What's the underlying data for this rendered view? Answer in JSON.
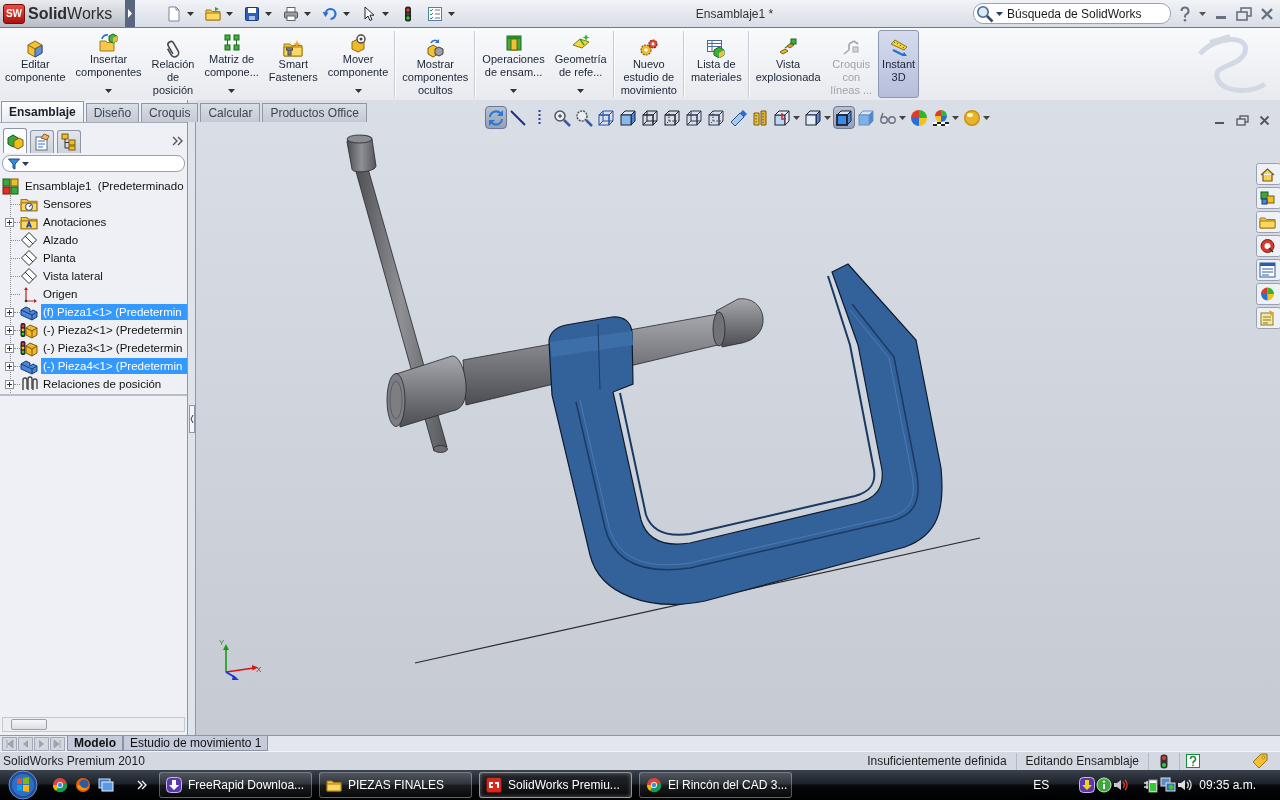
{
  "titlebar": {
    "logo_mark": "SW",
    "logo": "**Solid**Works",
    "title": "Ensamblaje1 *",
    "search": {
      "placeholder": "Búsqueda de SolidWorks"
    }
  },
  "ribbon": {
    "groups": [
      [
        {
          "label": "Editar\ncomponente",
          "dropdown": false,
          "disabled": false,
          "selected": false
        },
        {
          "label": "Insertar\ncomponentes",
          "dropdown": true,
          "disabled": false,
          "selected": false
        },
        {
          "label": "Relación\nde\nposición",
          "dropdown": false,
          "disabled": false,
          "selected": false
        },
        {
          "label": "Matriz de\ncompone...",
          "dropdown": true,
          "disabled": false,
          "selected": false
        },
        {
          "label": "Smart\nFasteners",
          "dropdown": false,
          "disabled": false,
          "selected": false
        },
        {
          "label": "Mover\ncomponente",
          "dropdown": true,
          "disabled": false,
          "selected": false
        }
      ],
      [
        {
          "label": "Mostrar\ncomponentes\nocultos",
          "dropdown": false,
          "disabled": false,
          "selected": false
        }
      ],
      [
        {
          "label": "Operaciones\nde ensam...",
          "dropdown": true,
          "disabled": false,
          "selected": false
        },
        {
          "label": "Geometría\nde refe...",
          "dropdown": true,
          "disabled": false,
          "selected": false
        }
      ],
      [
        {
          "label": "Nuevo\nestudio de\nmovimiento",
          "dropdown": false,
          "disabled": false,
          "selected": false
        }
      ],
      [
        {
          "label": "Lista de\nmateriales",
          "dropdown": false,
          "disabled": false,
          "selected": false
        }
      ],
      [
        {
          "label": "Vista\nexplosionada",
          "dropdown": false,
          "disabled": false,
          "selected": false
        },
        {
          "label": "Croquis\ncon\nlíneas ...",
          "dropdown": false,
          "disabled": true,
          "selected": false
        },
        {
          "label": "Instant\n3D",
          "dropdown": false,
          "disabled": false,
          "selected": true
        }
      ]
    ]
  },
  "command_tabs": [
    {
      "label": "Ensamblaje",
      "selected": true
    },
    {
      "label": "Diseño",
      "selected": false
    },
    {
      "label": "Croquis",
      "selected": false
    },
    {
      "label": "Calcular",
      "selected": false
    },
    {
      "label": "Productos Office",
      "selected": false
    }
  ],
  "panel_tabs": [
    {
      "selected": true
    },
    {
      "selected": false
    },
    {
      "selected": false
    }
  ],
  "feature_tree": {
    "root": {
      "label": "Ensamblaje1  (Predeterminado",
      "kind": "assembly",
      "selected": false,
      "children": [
        {
          "label": "Sensores",
          "kind": "sensors",
          "expandable": false,
          "selected": false
        },
        {
          "label": "Anotaciones",
          "kind": "annotations",
          "expandable": true,
          "selected": false
        },
        {
          "label": "Alzado",
          "kind": "plane",
          "expandable": false,
          "selected": false
        },
        {
          "label": "Planta",
          "kind": "plane",
          "expandable": false,
          "selected": false
        },
        {
          "label": "Vista lateral",
          "kind": "plane",
          "expandable": false,
          "selected": false
        },
        {
          "label": "Origen",
          "kind": "origin",
          "expandable": false,
          "selected": false
        },
        {
          "label": "(f) Pieza1<1> (Predetermin",
          "kind": "part",
          "expandable": true,
          "selected": true
        },
        {
          "label": "(-) Pieza2<1> (Predetermin",
          "kind": "part_rebuild",
          "expandable": true,
          "selected": false
        },
        {
          "label": "(-) Pieza3<1> (Predetermin",
          "kind": "part_rebuild",
          "expandable": true,
          "selected": false
        },
        {
          "label": "(-) Pieza4<1> (Predetermin",
          "kind": "part",
          "expandable": true,
          "selected": true
        },
        {
          "label": "Relaciones de posición",
          "kind": "mates",
          "expandable": true,
          "selected": false
        }
      ]
    }
  },
  "view_toolbar": [
    {
      "selected": true,
      "dropdown": false
    },
    {
      "selected": false,
      "dropdown": false
    },
    {
      "selected": false,
      "dropdown": false
    },
    {
      "selected": false,
      "dropdown": false
    },
    {
      "selected": false,
      "dropdown": false
    },
    {
      "selected": false,
      "dropdown": false
    },
    {
      "selected": false,
      "dropdown": false
    },
    {
      "selected": false,
      "dropdown": false
    },
    {
      "selected": false,
      "dropdown": false
    },
    {
      "selected": false,
      "dropdown": false
    },
    {
      "selected": false,
      "dropdown": false
    },
    {
      "selected": false,
      "dropdown": false
    },
    {
      "selected": false,
      "dropdown": false
    },
    {
      "selected": false,
      "dropdown": true
    },
    {
      "selected": false,
      "dropdown": true
    },
    {
      "selected": true,
      "dropdown": false
    },
    {
      "selected": false,
      "dropdown": false
    },
    {
      "selected": false,
      "dropdown": true
    },
    {
      "selected": false,
      "dropdown": false
    },
    {
      "selected": false,
      "dropdown": true
    },
    {
      "selected": false,
      "dropdown": true
    }
  ],
  "viewport": {
    "triad": {
      "y_label": "Y",
      "x_label": "X"
    }
  },
  "bottom_tabs": [
    {
      "label": "Modelo",
      "selected": true
    },
    {
      "label": "Estudio de movimiento 1",
      "selected": false
    }
  ],
  "status_bar": {
    "product": "SolidWorks Premium 2010",
    "fields": [
      "Insuficientemente definida",
      "Editando Ensamblaje"
    ]
  },
  "taskbar": {
    "tasks": [
      {
        "label": "FreeRapid Downloa...",
        "selected": false
      },
      {
        "label": "PIEZAS FINALES",
        "selected": false
      },
      {
        "label": "SolidWorks Premiu...",
        "selected": true
      },
      {
        "label": "El Rincón del CAD 3...",
        "selected": false
      }
    ],
    "language": "ES",
    "clock": "09:35 a.m."
  }
}
